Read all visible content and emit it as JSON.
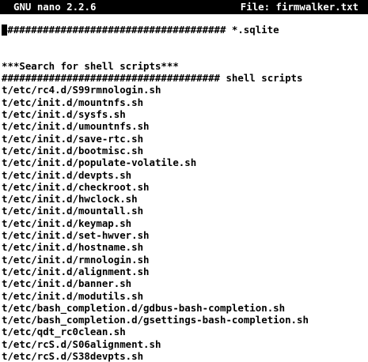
{
  "titlebar": {
    "app": "GNU nano 2.2.6",
    "file_label": "File: firmwalker.txt"
  },
  "editor": {
    "lines": [
      "###################################### *.sqlite",
      "",
      "",
      "***Search for shell scripts***",
      "##################################### shell scripts",
      "t/etc/rc4.d/S99rmnologin.sh",
      "t/etc/init.d/mountnfs.sh",
      "t/etc/init.d/sysfs.sh",
      "t/etc/init.d/umountnfs.sh",
      "t/etc/init.d/save-rtc.sh",
      "t/etc/init.d/bootmisc.sh",
      "t/etc/init.d/populate-volatile.sh",
      "t/etc/init.d/devpts.sh",
      "t/etc/init.d/checkroot.sh",
      "t/etc/init.d/hwclock.sh",
      "t/etc/init.d/mountall.sh",
      "t/etc/init.d/keymap.sh",
      "t/etc/init.d/set-hwver.sh",
      "t/etc/init.d/hostname.sh",
      "t/etc/init.d/rmnologin.sh",
      "t/etc/init.d/alignment.sh",
      "t/etc/init.d/banner.sh",
      "t/etc/init.d/modutils.sh",
      "t/etc/bash_completion.d/gdbus-bash-completion.sh",
      "t/etc/bash_completion.d/gsettings-bash-completion.sh",
      "t/etc/qdt_rc0clean.sh",
      "t/etc/rcS.d/S06alignment.sh",
      "t/etc/rcS.d/S38devpts.sh"
    ]
  }
}
